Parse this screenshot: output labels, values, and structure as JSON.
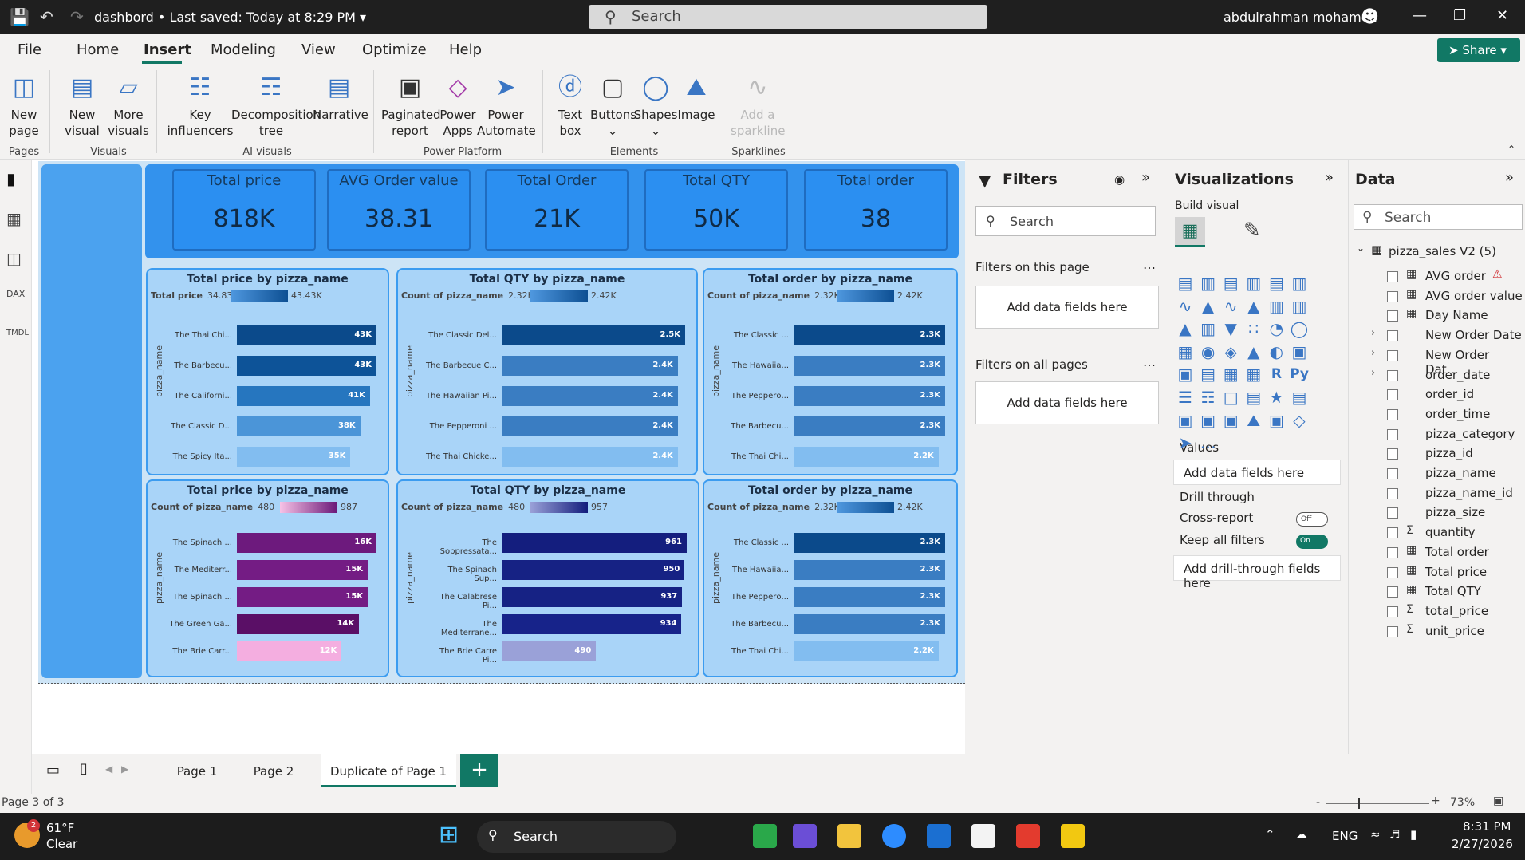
{
  "titlebar": {
    "doc_title": "dashbord",
    "saved": "Last saved: Today at 8:29 PM",
    "search_placeholder": "Search",
    "user": "abdulrahman mohamed"
  },
  "menu": {
    "items": [
      "File",
      "Home",
      "Insert",
      "Modeling",
      "View",
      "Optimize",
      "Help"
    ],
    "share": "Share"
  },
  "ribbon": {
    "buttons": {
      "new_page": "New page",
      "new_visual": "New visual",
      "more_visuals": "More visuals",
      "key_influencers": "Key influencers",
      "decomposition_tree": "Decomposition tree",
      "narrative": "Narrative",
      "paginated_report": "Paginated report",
      "power_apps": "Power Apps",
      "power_automate": "Power Automate",
      "text_box": "Text box",
      "buttons": "Buttons",
      "shapes": "Shapes",
      "image": "Image",
      "add_sparkline": "Add a sparkline"
    },
    "groups": {
      "pages": "Pages",
      "visuals": "Visuals",
      "ai_visuals": "AI visuals",
      "power_platform": "Power Platform",
      "elements": "Elements",
      "sparklines": "Sparklines"
    }
  },
  "kpis": [
    {
      "label": "Total price",
      "value": "818K"
    },
    {
      "label": "AVG Order value",
      "value": "38.31"
    },
    {
      "label": "Total Order",
      "value": "21K"
    },
    {
      "label": "Total QTY",
      "value": "50K"
    },
    {
      "label": "Total order",
      "value": "38"
    }
  ],
  "chart_data": [
    {
      "type": "bar",
      "title": "Total price by pizza_name",
      "legend_field": "Total price",
      "legend_min": "34.83K",
      "legend_max": "43.43K",
      "ylabel": "pizza_name",
      "categories": [
        "The Thai Chi...",
        "The Barbecu...",
        "The Californi...",
        "The Classic D...",
        "The Spicy Ita..."
      ],
      "values": [
        43,
        43,
        41,
        38,
        35
      ],
      "labels": [
        "43K",
        "43K",
        "41K",
        "38K",
        "35K"
      ],
      "xmax": 43,
      "colors": [
        "#0b4a8b",
        "#0d5398",
        "#2676bf",
        "#4b95d8",
        "#82bdf0"
      ]
    },
    {
      "type": "bar",
      "title": "Total QTY by pizza_name",
      "legend_field": "Count of pizza_name",
      "legend_min": "2.32K",
      "legend_max": "2.42K",
      "ylabel": "pizza_name",
      "categories": [
        "The Classic Del...",
        "The Barbecue C...",
        "The Hawaiian Pi...",
        "The Pepperoni ...",
        "The Thai Chicke..."
      ],
      "values": [
        2.5,
        2.4,
        2.4,
        2.4,
        2.4
      ],
      "labels": [
        "2.5K",
        "2.4K",
        "2.4K",
        "2.4K",
        "2.4K"
      ],
      "xmax": 2.5,
      "colors": [
        "#0b4a8b",
        "#3a7dc2",
        "#3a7dc2",
        "#3a7dc2",
        "#82bdf0"
      ]
    },
    {
      "type": "bar",
      "title": "Total order by pizza_name",
      "legend_field": "Count of pizza_name",
      "legend_min": "2.32K",
      "legend_max": "2.42K",
      "ylabel": "pizza_name",
      "categories": [
        "The Classic ...",
        "The Hawaiia...",
        "The Pepperо...",
        "The Barbecu...",
        "The Thai Chi..."
      ],
      "values": [
        2.3,
        2.3,
        2.3,
        2.3,
        2.2
      ],
      "labels": [
        "2.3K",
        "2.3K",
        "2.3K",
        "2.3K",
        "2.2K"
      ],
      "xmax": 2.3,
      "colors": [
        "#0b4a8b",
        "#3a7dc2",
        "#3a7dc2",
        "#3a7dc2",
        "#82bdf0"
      ]
    },
    {
      "type": "bar",
      "title": "Total price by pizza_name",
      "legend_field": "Count of pizza_name",
      "legend_min": "480",
      "legend_max": "987",
      "ylabel": "pizza_name",
      "categories": [
        "The Spinach ...",
        "The Mediterr...",
        "The Spinach ...",
        "The Green Ga...",
        "The Brie Carr..."
      ],
      "values": [
        16,
        15,
        15,
        14,
        12
      ],
      "labels": [
        "16K",
        "15K",
        "15K",
        "14K",
        "12K"
      ],
      "xmax": 16,
      "colors": [
        "#6d1a7d",
        "#741c84",
        "#741c84",
        "#5a0f66",
        "#f4aee0"
      ]
    },
    {
      "type": "bar",
      "title": "Total QTY by pizza_name",
      "legend_field": "Count of pizza_name",
      "legend_min": "480",
      "legend_max": "957",
      "ylabel": "pizza_name",
      "categories": [
        "The Soppressata...",
        "The Spinach Sup...",
        "The Calabrese Pi...",
        "The Mediterrane...",
        "The Brie Carre Pi..."
      ],
      "values": [
        961,
        950,
        937,
        934,
        490
      ],
      "labels": [
        "961",
        "950",
        "937",
        "934",
        "490"
      ],
      "xmax": 961,
      "colors": [
        "#141e7e",
        "#162284",
        "#162284",
        "#17238a",
        "#9aa1d8"
      ]
    },
    {
      "type": "bar",
      "title": "Total order by pizza_name",
      "legend_field": "Count of pizza_name",
      "legend_min": "2.32K",
      "legend_max": "2.42K",
      "ylabel": "pizza_name",
      "categories": [
        "The Classic ...",
        "The Hawaiia...",
        "The Pepperо...",
        "The Barbecu...",
        "The Thai Chi..."
      ],
      "values": [
        2.3,
        2.3,
        2.3,
        2.3,
        2.2
      ],
      "labels": [
        "2.3K",
        "2.3K",
        "2.3K",
        "2.3K",
        "2.2K"
      ],
      "xmax": 2.3,
      "colors": [
        "#0b4a8b",
        "#3a7dc2",
        "#3a7dc2",
        "#3a7dc2",
        "#82bdf0"
      ]
    }
  ],
  "pagetabs": {
    "tabs": [
      "Page 1",
      "Page 2",
      "Duplicate of Page 1"
    ],
    "add": "+"
  },
  "status": {
    "page": "Page 3 of 3",
    "zoom": "73%"
  },
  "filters": {
    "title": "Filters",
    "search": "Search",
    "this_page": "Filters on this page",
    "all_pages": "Filters on all pages",
    "add_fields": "Add data fields here"
  },
  "visualizations": {
    "title": "Visualizations",
    "build": "Build visual",
    "values": "Values",
    "values_drop": "Add data fields here",
    "drill": "Drill through",
    "cross_report": "Cross-report",
    "cross_state": "Off",
    "keep_filters": "Keep all filters",
    "keep_state": "On",
    "drill_drop": "Add drill-through fields here"
  },
  "data": {
    "title": "Data",
    "search": "Search",
    "table": "pizza_sales V2 (5)",
    "fields": [
      "AVG order",
      "AVG order value",
      "Day Name",
      "New Order Date",
      "New Order Dat...",
      "order_date",
      "order_id",
      "order_time",
      "pizza_category",
      "pizza_id",
      "pizza_name",
      "pizza_name_id",
      "pizza_size",
      "quantity",
      "Total order",
      "Total price",
      "Total QTY",
      "total_price",
      "unit_price"
    ]
  },
  "taskbar": {
    "temp": "61°F",
    "weather": "Clear",
    "badge": "2",
    "search": "Search",
    "lang": "ENG",
    "time": "8:31 PM",
    "date": "2/27/2026"
  }
}
